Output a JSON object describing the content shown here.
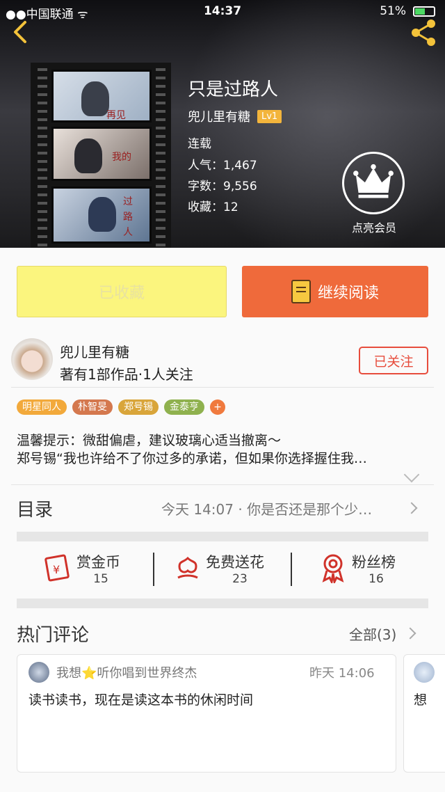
{
  "status_bar": {
    "carrier": "中国联通",
    "time": "14:37",
    "battery": "51%"
  },
  "book": {
    "title": "只是过路人",
    "author": "兜儿里有糖",
    "level": "Lv1",
    "status": "连载",
    "popularity": "人气：1,467",
    "word_count": "字数：9,556",
    "favorites": "收藏：12",
    "cover_text": [
      "再见",
      "我的",
      "过",
      "路",
      "人"
    ]
  },
  "vip": {
    "label": "点亮会员"
  },
  "actions": {
    "favorite_label": "已收藏",
    "read_label": "继续阅读"
  },
  "author_card": {
    "name": "兜儿里有糖",
    "summary": "著有1部作品·1人关注",
    "follow_label": "已关注"
  },
  "tags": [
    {
      "label": "明星同人",
      "color": "#f2a93b"
    },
    {
      "label": "朴智旻",
      "color": "#d4784e"
    },
    {
      "label": "郑号锡",
      "color": "#d9a53a"
    },
    {
      "label": "金泰亨",
      "color": "#8fb14e"
    },
    {
      "label": "+",
      "color": "#f07a3e"
    }
  ],
  "notice": {
    "line1": "温馨提示：微甜偏虐，建议玻璃心适当撤离～",
    "line2": "郑号锡“我也许给不了你过多的承诺，但如果你选择握住我…"
  },
  "toc": {
    "label": "目录",
    "latest": "今天 14:07 · 你是否还是那个少…"
  },
  "stats": [
    {
      "label": "赏金币",
      "value": "15"
    },
    {
      "label": "免费送花",
      "value": "23"
    },
    {
      "label": "粉丝榜",
      "value": "16"
    }
  ],
  "comments": {
    "section_label": "热门评论",
    "all_label": "全部(3)",
    "items": [
      {
        "user": "我想⭐听你唱到世界终杰",
        "time": "昨天 14:06",
        "text": "读书读书，现在是读这本书的休闲时间"
      }
    ],
    "next_preview": "想"
  },
  "colors": {
    "accent": "#ef6a3b",
    "fav_bg": "#fbf57e",
    "follow": "#e74c3c"
  }
}
